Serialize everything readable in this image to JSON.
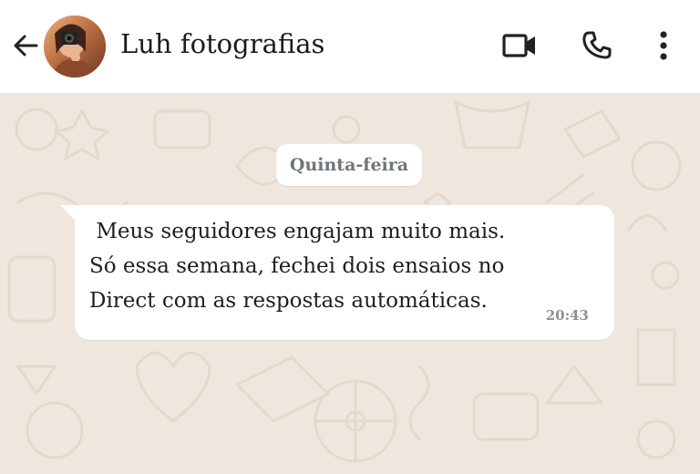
{
  "header": {
    "contact_name": "Luh fotografias",
    "icons": {
      "back": "arrow-back-icon",
      "avatar": "contact-avatar",
      "video": "video-camera-icon",
      "call": "phone-icon",
      "more": "more-vertical-icon"
    }
  },
  "chat": {
    "date_label": "Quinta-feira",
    "messages": [
      {
        "text": " Meus seguidores engajam muito mais.\nSó essa semana, fechei dois ensaios no\nDirect com as respostas automáticas.",
        "time": "20:43",
        "direction": "incoming"
      }
    ]
  },
  "colors": {
    "header_bg": "#ffffff",
    "chat_bg": "#efe7dd",
    "bubble_bg": "#ffffff",
    "date_text": "#6f767a",
    "time_text": "#8a8f93"
  }
}
